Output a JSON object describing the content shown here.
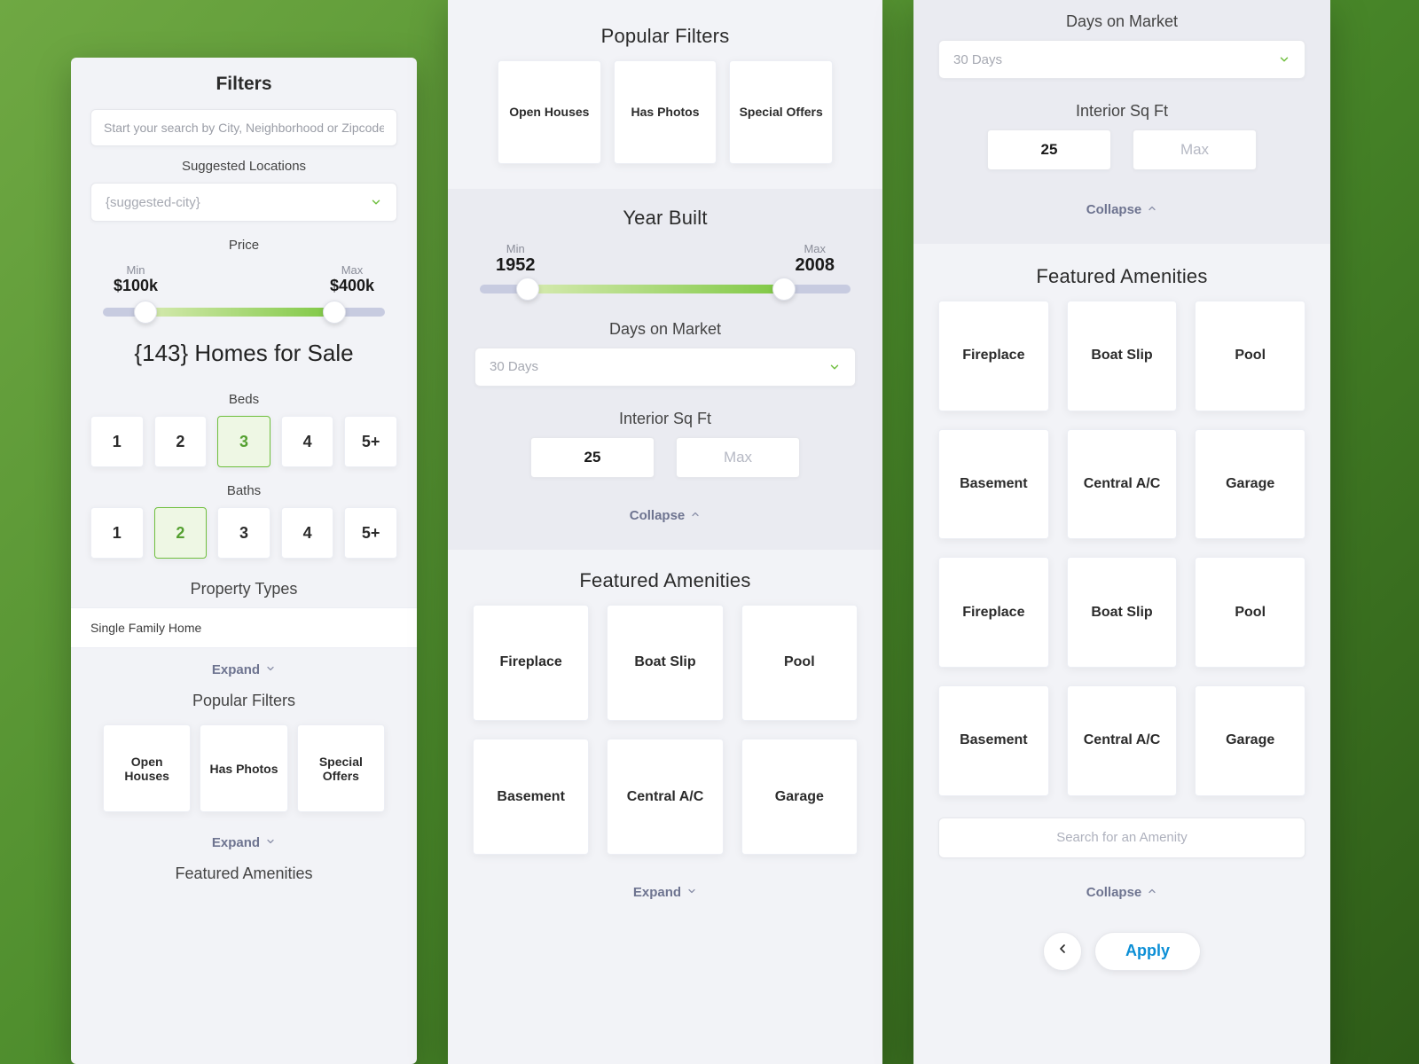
{
  "panel1": {
    "title": "Filters",
    "searchPlaceholder": "Start your search by City, Neighborhood or Zipcode",
    "suggestedLabel": "Suggested Locations",
    "suggestedValue": "{suggested-city}",
    "price": {
      "label": "Price",
      "minLabel": "Min",
      "maxLabel": "Max",
      "minValue": "$100k",
      "maxValue": "$400k"
    },
    "countLine": "{143} Homes for Sale",
    "bedsLabel": "Beds",
    "beds": [
      "1",
      "2",
      "3",
      "4",
      "5+"
    ],
    "bedsSelected": 2,
    "bathsLabel": "Baths",
    "baths": [
      "1",
      "2",
      "3",
      "4",
      "5+"
    ],
    "bathsSelected": 1,
    "propTypesLabel": "Property Types",
    "propType": "Single Family Home",
    "expand": "Expand",
    "popularLabel": "Popular Filters",
    "popular": [
      "Open Houses",
      "Has Photos",
      "Special Offers"
    ],
    "amenitiesLabel": "Featured Amenities"
  },
  "panel2": {
    "popularLabel": "Popular Filters",
    "popular": [
      "Open Houses",
      "Has Photos",
      "Special Offers"
    ],
    "year": {
      "label": "Year Built",
      "minLabel": "Min",
      "maxLabel": "Max",
      "minValue": "1952",
      "maxValue": "2008"
    },
    "domLabel": "Days on Market",
    "domValue": "30 Days",
    "sqftLabel": "Interior Sq Ft",
    "sqftMin": "25",
    "sqftMaxPlaceholder": "Max",
    "collapse": "Collapse",
    "amenitiesLabel": "Featured Amenities",
    "amenities": [
      "Fireplace",
      "Boat Slip",
      "Pool",
      "Basement",
      "Central A/C",
      "Garage"
    ],
    "expand": "Expand"
  },
  "panel3": {
    "domLabel": "Days on Market",
    "domValue": "30 Days",
    "sqftLabel": "Interior Sq Ft",
    "sqftMin": "25",
    "sqftMaxPlaceholder": "Max",
    "collapse": "Collapse",
    "amenitiesLabel": "Featured Amenities",
    "amenities": [
      "Fireplace",
      "Boat Slip",
      "Pool",
      "Basement",
      "Central A/C",
      "Garage",
      "Fireplace",
      "Boat Slip",
      "Pool",
      "Basement",
      "Central A/C",
      "Garage"
    ],
    "amenitySearchPlaceholder": "Search for an Amenity",
    "applyLabel": "Apply"
  }
}
